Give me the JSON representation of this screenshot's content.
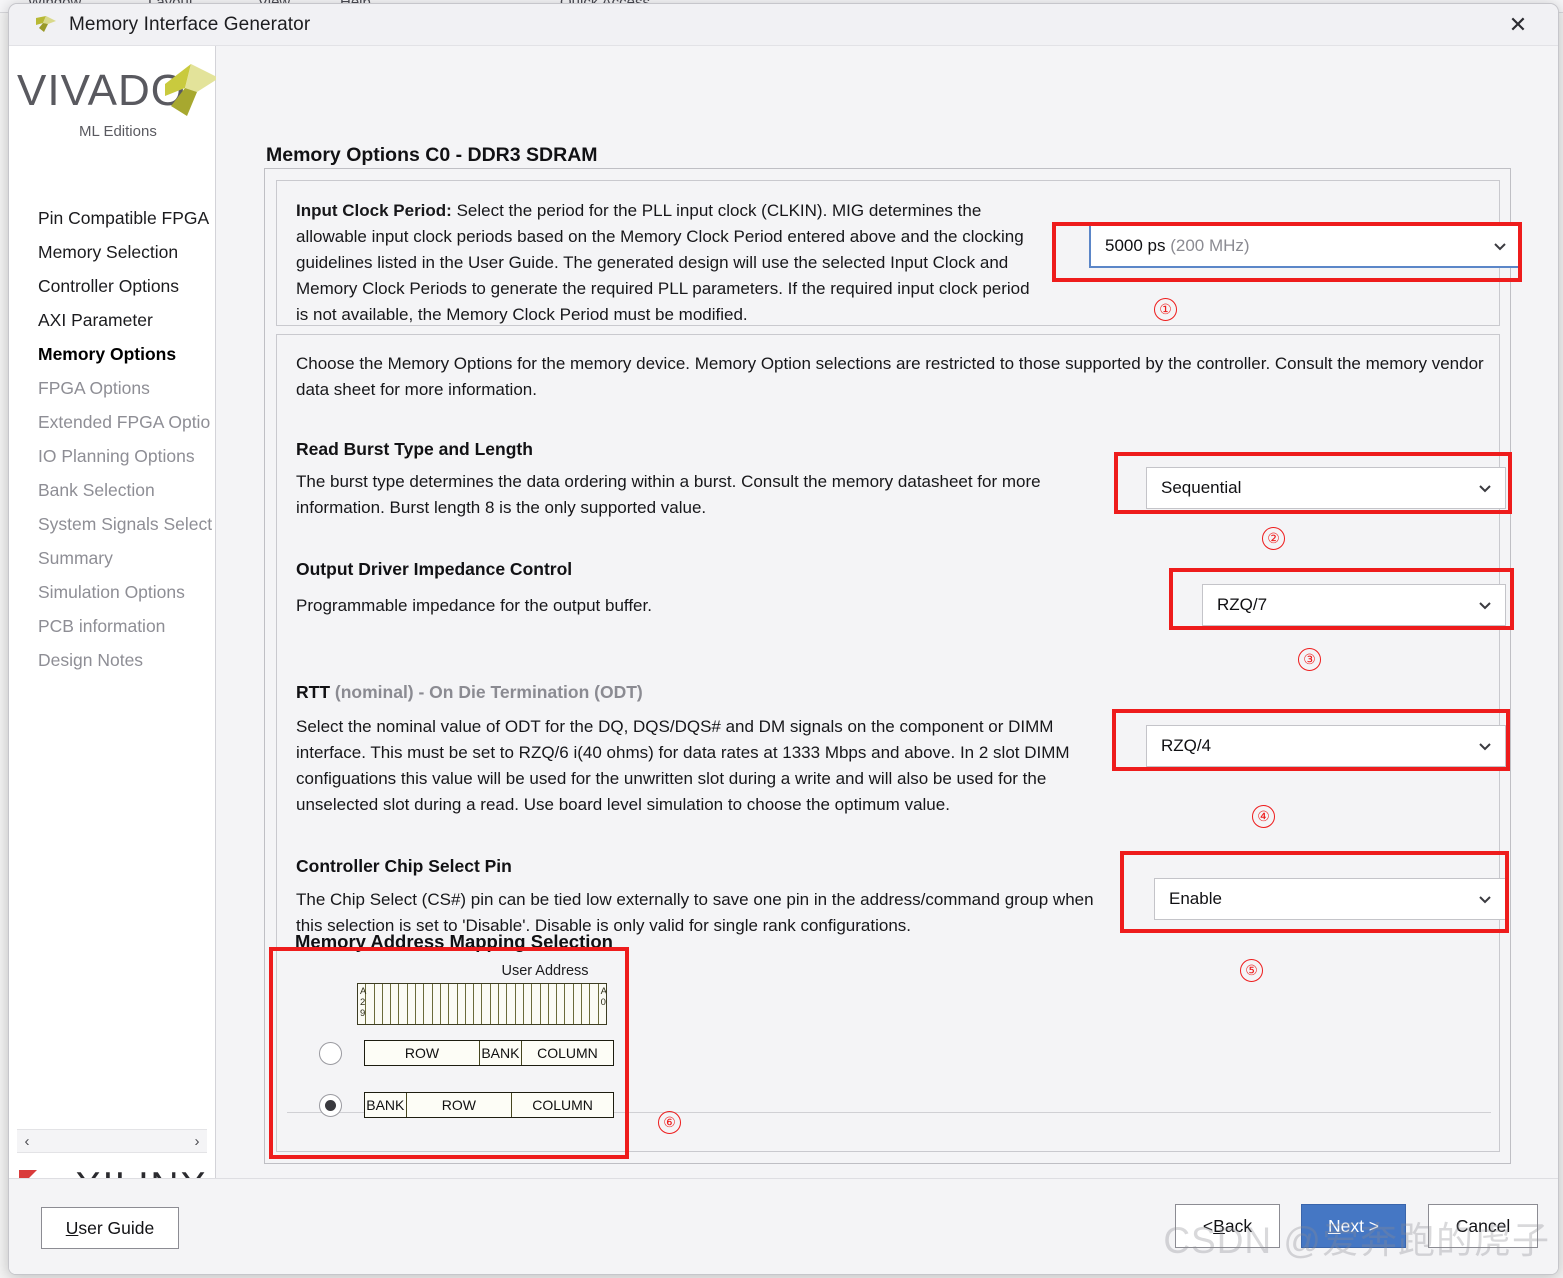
{
  "background": {
    "menu_items": [
      "Window",
      "Layout",
      "View",
      "Help",
      "Quick Access"
    ]
  },
  "window": {
    "title": "Memory Interface Generator",
    "close_label": "✕"
  },
  "sidebar": {
    "logo": {
      "brand": "VIVADO",
      "dot": ".",
      "subtitle": "ML Editions"
    },
    "items": [
      {
        "label": "Pin Compatible FPGA",
        "state": "normal"
      },
      {
        "label": "Memory Selection",
        "state": "normal"
      },
      {
        "label": "Controller Options",
        "state": "normal"
      },
      {
        "label": "AXI Parameter",
        "state": "normal"
      },
      {
        "label": "Memory Options",
        "state": "current"
      },
      {
        "label": "FPGA Options",
        "state": "dim"
      },
      {
        "label": "Extended FPGA Optio",
        "state": "dim"
      },
      {
        "label": "IO Planning Options",
        "state": "dim"
      },
      {
        "label": "Bank Selection",
        "state": "dim"
      },
      {
        "label": "System Signals Select",
        "state": "dim"
      },
      {
        "label": "Summary",
        "state": "dim"
      },
      {
        "label": "Simulation Options",
        "state": "dim"
      },
      {
        "label": "PCB information",
        "state": "dim"
      },
      {
        "label": "Design Notes",
        "state": "dim"
      }
    ],
    "scroll": {
      "left_arrow": "‹",
      "right_arrow": "›"
    },
    "footer_logo": {
      "brand": "XILINX",
      "trademark": "®"
    }
  },
  "main": {
    "page_title": "Memory Options C0 - DDR3 SDRAM",
    "clock_section": {
      "label": "Input Clock Period:",
      "description": " Select the period for the PLL input clock (CLKIN). MIG determines the allowable input clock periods based on the Memory Clock Period entered above and the clocking guidelines listed in the User Guide. The generated design will use the selected Input Clock and Memory Clock Periods to generate the required PLL parameters. If the required input clock period is not available, the Memory Clock Period must be modified.",
      "dropdown": {
        "value": "5000 ps",
        "suffix": "(200 MHz)"
      },
      "marker": "①"
    },
    "intro": "Choose the Memory Options for the memory device. Memory Option selections are restricted to those supported by the controller. Consult the memory vendor data sheet for more information.",
    "sections": [
      {
        "heading": "Read Burst Type and Length",
        "heading_gray": "",
        "body": "The burst type determines the data ordering within a burst. Consult the memory datasheet for more information. Burst length 8 is the only supported value.",
        "dropdown": "Sequential",
        "marker": "②"
      },
      {
        "heading": "Output Driver Impedance Control",
        "heading_gray": "",
        "body": "Programmable impedance for the output buffer.",
        "dropdown": "RZQ/7",
        "marker": "③"
      },
      {
        "heading": "RTT",
        "heading_gray": " (nominal) - On Die Termination (ODT)",
        "body": "Select the nominal value of ODT for the DQ, DQS/DQS# and DM signals on the component or DIMM interface. This must be set to RZQ/6 i(40 ohms) for data rates at 1333 Mbps and above. In 2 slot DIMM configuations this value will be used for the unwritten slot during a write and will also be used for the unselected slot during a read. Use board level simulation to choose the optimum value.",
        "dropdown": "RZQ/4",
        "marker": "④"
      },
      {
        "heading": "Controller Chip Select Pin",
        "heading_gray": "",
        "body": "The Chip Select (CS#) pin can be tied low externally to save one pin in the address/command group when this selection is set to 'Disable'. Disable is only valid for single rank configurations.",
        "dropdown": "Enable",
        "marker": "⑤"
      }
    ],
    "address_mapping": {
      "title": "Memory Address Mapping Selection",
      "user_address_label": "User Address",
      "bit_high": "A\n2\n9",
      "bit_high_chars": [
        "A",
        "2",
        "9"
      ],
      "bit_low_chars": [
        "A",
        "0"
      ],
      "cell_count": 30,
      "marker": "⑥",
      "options": [
        {
          "selected": false,
          "segments": [
            {
              "label": "ROW",
              "flex": 100
            },
            {
              "label": "BANK",
              "flex": 36
            },
            {
              "label": "COLUMN",
              "flex": 80
            }
          ]
        },
        {
          "selected": true,
          "segments": [
            {
              "label": "BANK",
              "flex": 33
            },
            {
              "label": "ROW",
              "flex": 85
            },
            {
              "label": "COLUMN",
              "flex": 82
            }
          ]
        }
      ]
    }
  },
  "footer": {
    "user_guide": {
      "mnemonic": "U",
      "rest": "ser Guide"
    },
    "back": {
      "prefix": "< ",
      "mnemonic": "B",
      "rest": "ack"
    },
    "next": {
      "mnemonic": "N",
      "rest": "ext >"
    },
    "cancel": "Cancel"
  },
  "watermark": "CSDN @爱奔跑的虎子",
  "colors": {
    "highlight_red": "#ee1c1c",
    "primary_blue": "#4577c4",
    "focus_blue": "#5b86c8",
    "vivado_gray": "#59595f",
    "xilinx_red": "#c1262d"
  }
}
